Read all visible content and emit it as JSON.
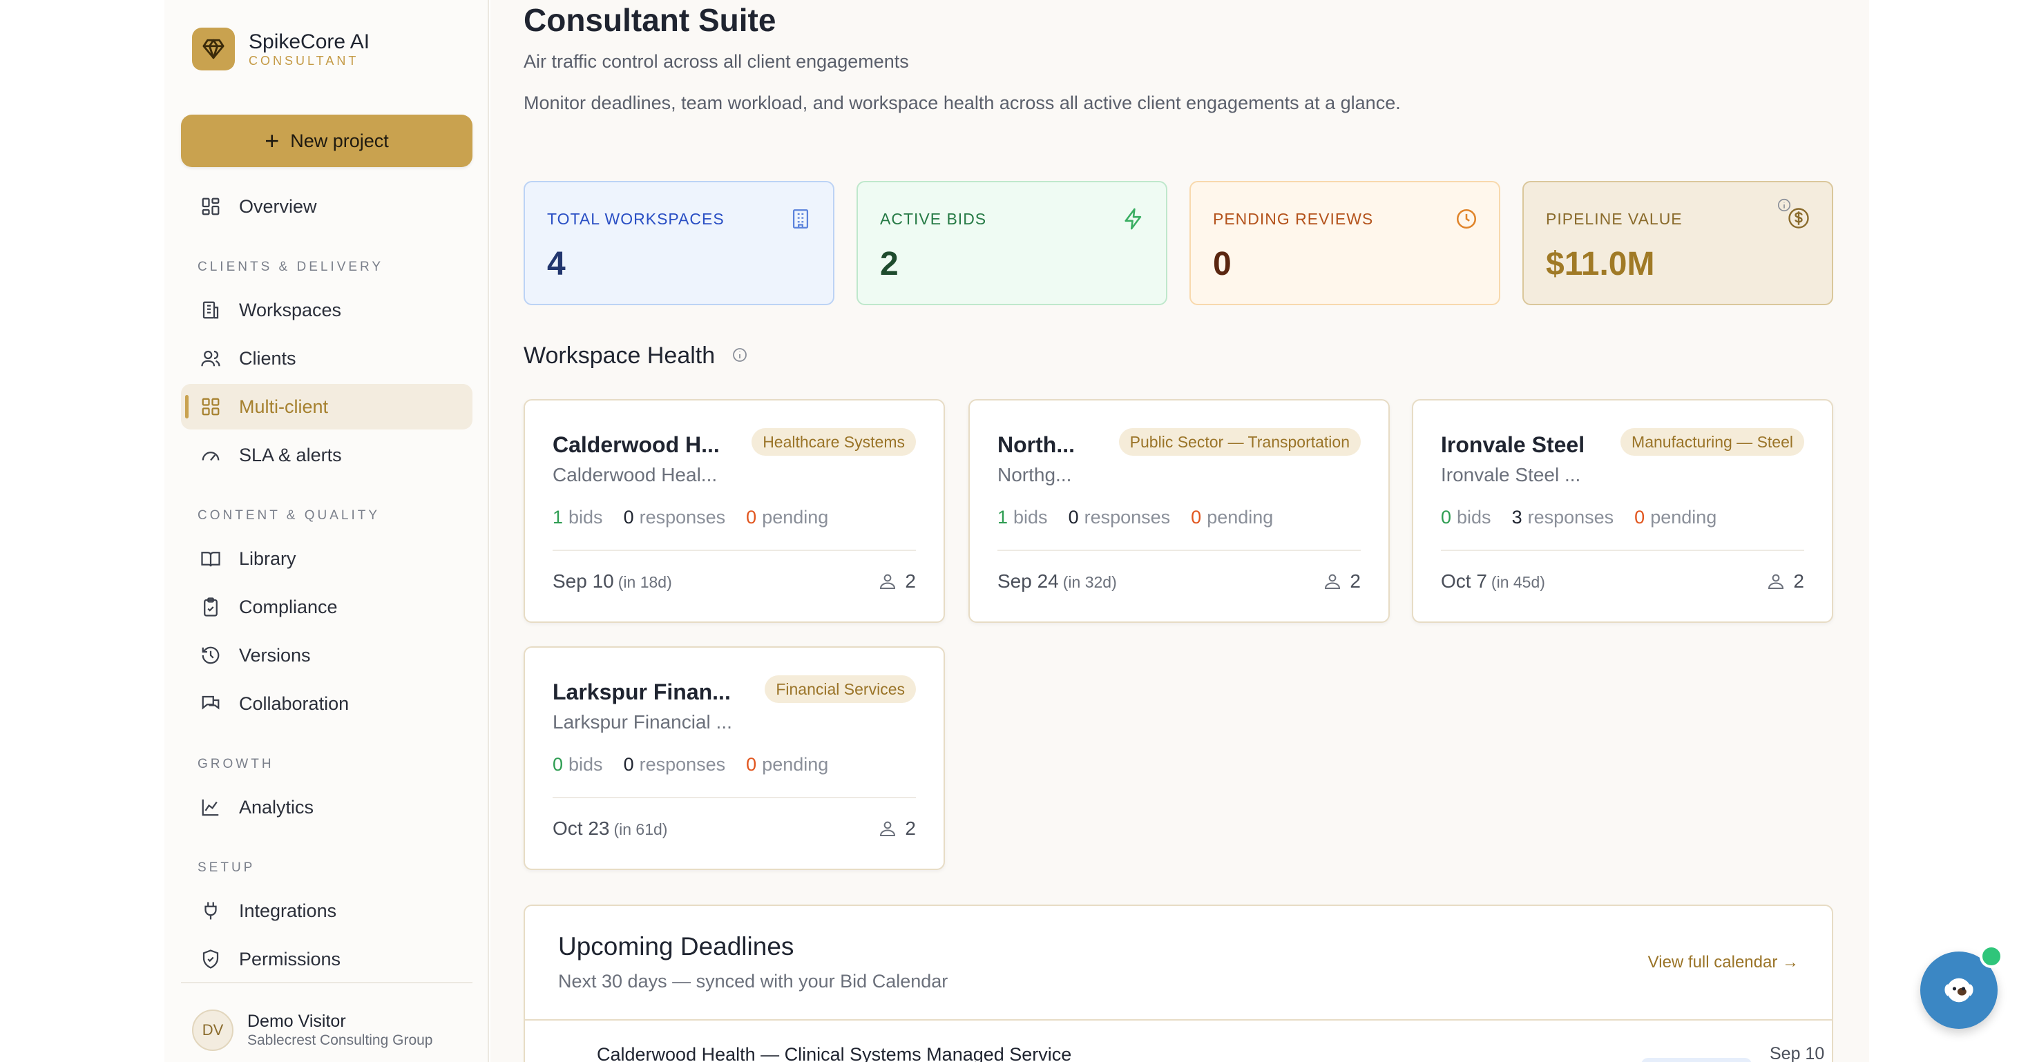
{
  "brand": {
    "name": "SpikeCore AI",
    "subtitle": "CONSULTANT"
  },
  "sidebar": {
    "new_project": "New project",
    "overview": "Overview",
    "sections": [
      {
        "label": "CLIENTS & DELIVERY",
        "items": [
          "Workspaces",
          "Clients",
          "Multi-client",
          "SLA & alerts"
        ]
      },
      {
        "label": "CONTENT & QUALITY",
        "items": [
          "Library",
          "Compliance",
          "Versions",
          "Collaboration"
        ]
      },
      {
        "label": "GROWTH",
        "items": [
          "Analytics"
        ]
      },
      {
        "label": "SETUP",
        "items": [
          "Integrations",
          "Permissions"
        ]
      }
    ],
    "active_item": "Multi-client",
    "user": {
      "initials": "DV",
      "name": "Demo Visitor",
      "org": "Sablecrest Consulting Group"
    }
  },
  "header": {
    "title": "Consultant Suite",
    "subtitle": "Air traffic control across all client engagements",
    "description": "Monitor deadlines, team workload, and workspace health across all active client engagements at a glance."
  },
  "stats": [
    {
      "label": "TOTAL WORKSPACES",
      "value": "4",
      "icon": "building-icon"
    },
    {
      "label": "ACTIVE BIDS",
      "value": "2",
      "icon": "lightning-icon"
    },
    {
      "label": "PENDING REVIEWS",
      "value": "0",
      "icon": "clock-icon"
    },
    {
      "label": "PIPELINE VALUE",
      "value": "$11.0M",
      "icon": "dollar-icon"
    }
  ],
  "workspace_health": {
    "title": "Workspace Health",
    "cards": [
      {
        "name": "Calderwood H...",
        "tag": "Healthcare Systems",
        "client": "Calderwood Heal...",
        "bids": "1",
        "responses": "0",
        "pending": "0",
        "date": "Sep 10",
        "relative": "(in 18d)",
        "members": "2"
      },
      {
        "name": "North...",
        "tag": "Public Sector — Transportation",
        "client": "Northg...",
        "bids": "1",
        "responses": "0",
        "pending": "0",
        "date": "Sep 24",
        "relative": "(in 32d)",
        "members": "2"
      },
      {
        "name": "Ironvale Steel",
        "tag": "Manufacturing — Steel",
        "client": "Ironvale Steel ...",
        "bids": "0",
        "responses": "3",
        "pending": "0",
        "date": "Oct 7",
        "relative": "(in 45d)",
        "members": "2"
      },
      {
        "name": "Larkspur Finan...",
        "tag": "Financial Services",
        "client": "Larkspur Financial ...",
        "bids": "0",
        "responses": "0",
        "pending": "0",
        "date": "Oct 23",
        "relative": "(in 61d)",
        "members": "2"
      }
    ],
    "labels": {
      "bids": "bids",
      "responses": "responses",
      "pending": "pending"
    }
  },
  "deadlines": {
    "title": "Upcoming Deadlines",
    "subtitle": "Next 30 days — synced with your Bid Calendar",
    "link": "View full calendar →",
    "rows": [
      {
        "name": "Calderwood Health — Clinical Systems Managed Service",
        "date": "Sep 10"
      }
    ]
  },
  "colors": {
    "accent": "#c9a24f",
    "green": "#2e9d52",
    "orange": "#e1561f",
    "blue": "#2a4fc4"
  }
}
